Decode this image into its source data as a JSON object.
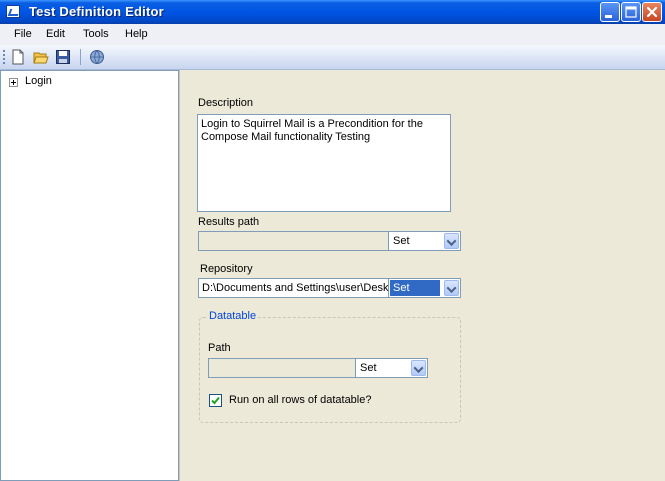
{
  "window": {
    "title": "Test Definition Editor"
  },
  "menu": {
    "items": [
      "File",
      "Edit",
      "Tools",
      "Help"
    ]
  },
  "toolbar": {
    "buttons": [
      "new-document-icon",
      "open-folder-icon",
      "save-disk-icon",
      "help-globe-icon"
    ]
  },
  "tree": {
    "root_label": "Login"
  },
  "form": {
    "description_label": "Description",
    "description_line1": "Login to Squirrel Mail is a Precondition for the",
    "description_line2": "Compose Mail functionality Testing",
    "results_path_label": "Results path",
    "results_path_value": "",
    "results_set_label": "Set",
    "repository_label": "Repository",
    "repository_value": "D:\\Documents and Settings\\user\\Deskt",
    "repository_set_label": "Set"
  },
  "datatable": {
    "title": "Datatable",
    "path_label": "Path",
    "path_value": "",
    "set_label": "Set",
    "run_all_rows_label": "Run on all rows of datatable?",
    "run_all_rows_checked": true
  },
  "colors": {
    "titlebar": "#0055e5",
    "group_title": "#0046d5",
    "selection": "#316ac5"
  }
}
